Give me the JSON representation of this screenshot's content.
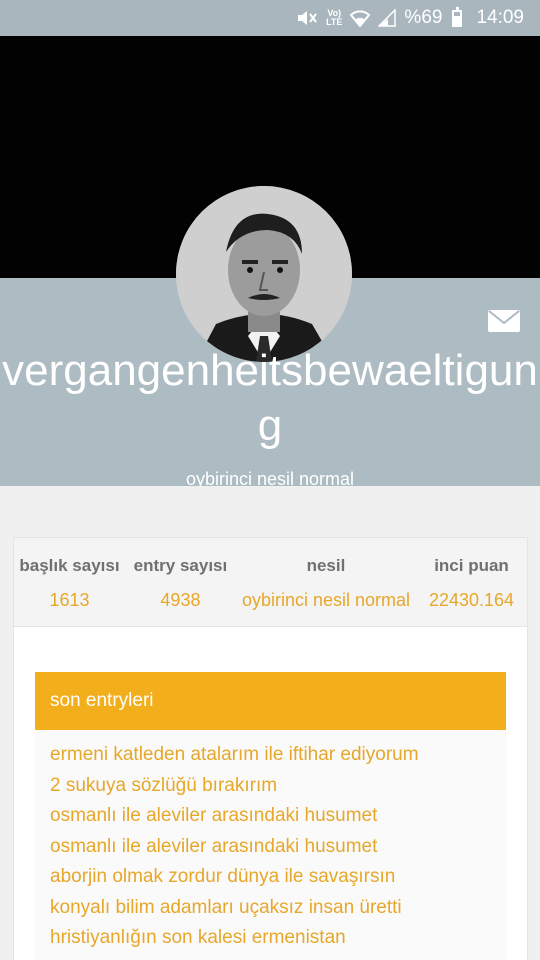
{
  "status_bar": {
    "volte_line1": "Vo)",
    "volte_line2": "LTE",
    "battery_text": "%69",
    "battery_level_percent": 69,
    "time": "14:09",
    "icons": [
      "mute-icon",
      "volte-icon",
      "wifi-icon",
      "signal-icon",
      "battery-icon"
    ]
  },
  "profile": {
    "username": "vergangenheitsbewaeltigung",
    "generation_subtitle": "oybirinci nesil normal",
    "avatar_icon": "avatar-portrait",
    "message_icon": "mail-icon"
  },
  "stats": [
    {
      "label": "başlık sayısı",
      "value": "1613"
    },
    {
      "label": "entry sayısı",
      "value": "4938"
    },
    {
      "label": "nesil",
      "value": "oybirinci nesil normal"
    },
    {
      "label": "inci puan",
      "value": "22430.164"
    }
  ],
  "recent_entries": {
    "header": "son entryleri",
    "items": [
      "ermeni katleden atalarım ile iftihar ediyorum",
      "2 sukuya sözlüğü bırakırım",
      "osmanlı ile aleviler arasındaki husumet",
      "osmanlı ile aleviler arasındaki husumet",
      "aborjin olmak zordur dünya ile savaşırsın",
      "konyalı bilim adamları uçaksız insan üretti",
      "hristiyanlığın son kalesi ermenistan"
    ]
  },
  "colors": {
    "status_bar": "#a9b6be",
    "profile_band": "#adbbc3",
    "accent": "#f3ae1c",
    "link": "#e7a72a"
  }
}
